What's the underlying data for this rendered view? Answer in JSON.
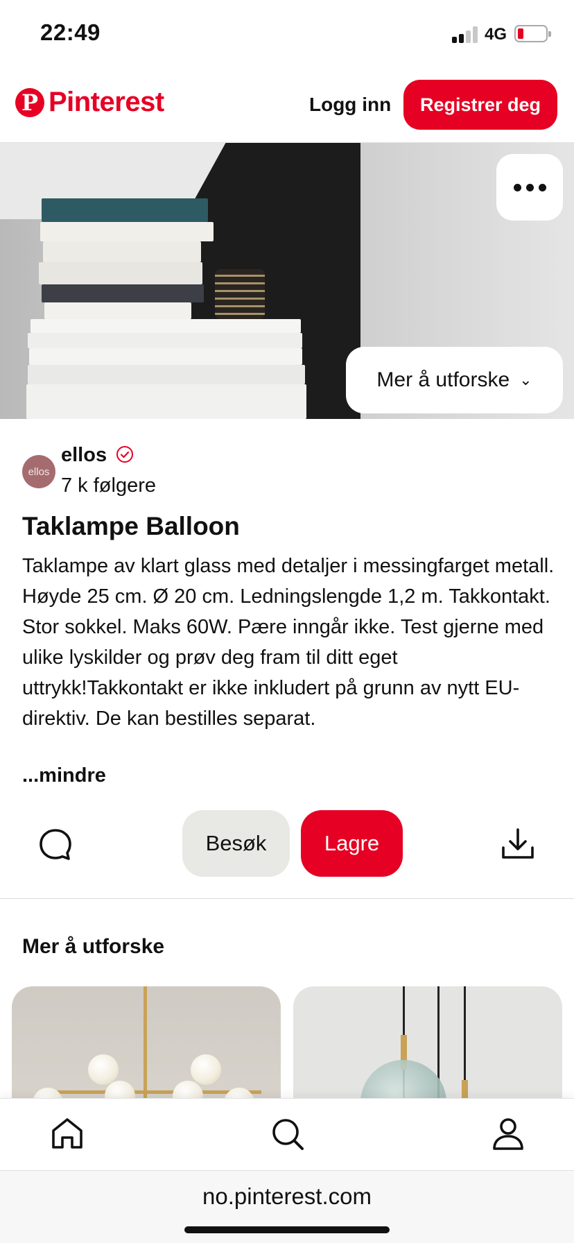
{
  "status_bar": {
    "time": "22:49",
    "network": "4G",
    "battery_color": "#e60023"
  },
  "header": {
    "logo_mark": "P",
    "logo_text": "Pinterest",
    "login_label": "Logg inn",
    "register_label": "Registrer deg",
    "brand_color": "#e60023"
  },
  "hero": {
    "explore_label": "Mer å utforske"
  },
  "creator": {
    "avatar_text": "ellos",
    "name": "ellos",
    "followers": "7 k følgere"
  },
  "pin": {
    "title": "Taklampe Balloon",
    "description": "Taklampe av klart glass med detaljer i messingfarget metall. Høyde 25 cm. Ø 20 cm. Ledningslengde 1,2 m. Takkontakt. Stor sokkel. Maks 60W. Pære inngår ikke. Test gjerne med ulike lyskilder og prøv deg fram til ditt eget uttrykk!Takkontakt er ikke inkludert på grunn av nytt EU-direktiv. De kan bestilles separat.",
    "less_label": "...mindre"
  },
  "actions": {
    "visit_label": "Besøk",
    "save_label": "Lagre"
  },
  "explore": {
    "heading": "Mer å utforske"
  },
  "browser": {
    "url": "no.pinterest.com"
  }
}
